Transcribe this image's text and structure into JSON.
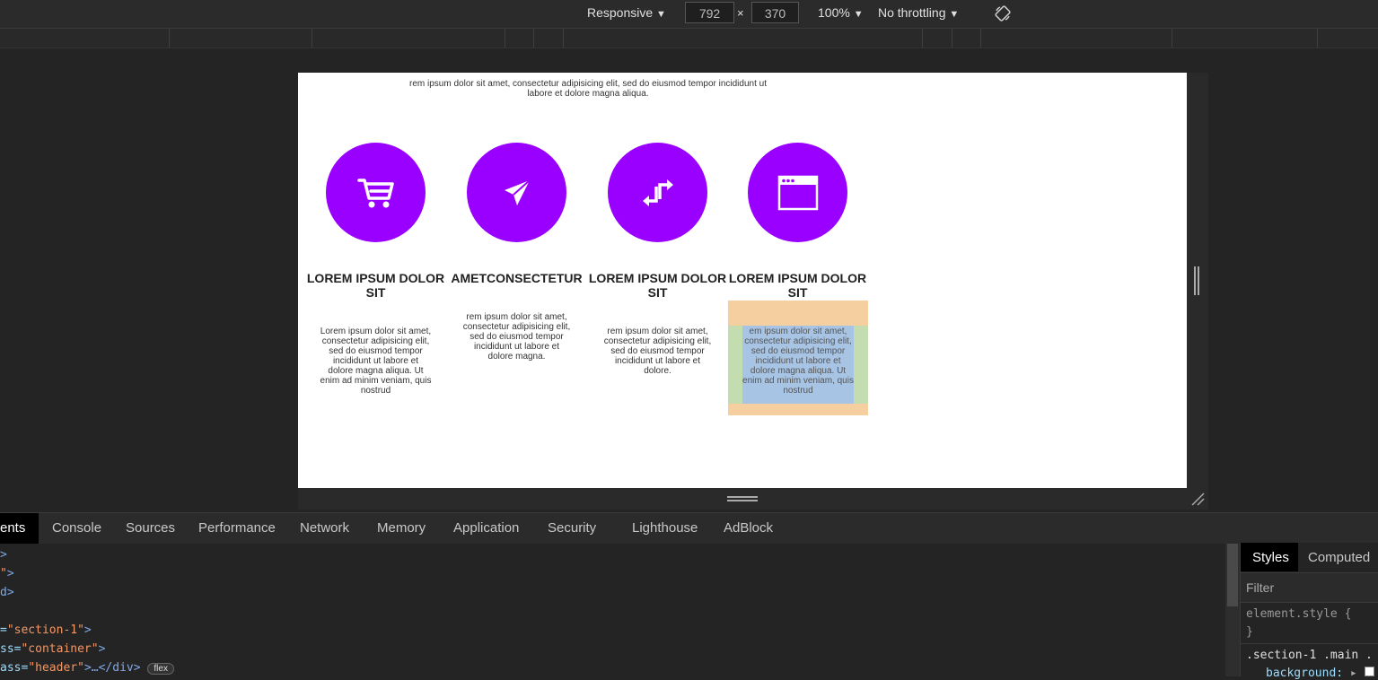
{
  "device_toolbar": {
    "mode": "Responsive",
    "width": "792",
    "times": "×",
    "height": "370",
    "zoom": "100%",
    "throttling": "No throttling",
    "caret": "▼",
    "rotate_icon": "rotate-icon"
  },
  "page": {
    "intro_line1": "rem ipsum dolor sit amet, consectetur adipisicing elit, sed do eiusmod tempor incididunt ut",
    "intro_line2": "labore et dolore magna aliqua.",
    "cards": [
      {
        "icon": "cart-icon",
        "title": "LOREM IPSUM DOLOR SIT",
        "text": "Lorem ipsum dolor sit amet, consectetur adipisicing elit, sed do eiusmod tempor incididunt ut labore et dolore magna aliqua. Ut enim ad minim veniam, quis nostrud"
      },
      {
        "icon": "paper-plane-icon",
        "title": "AMETCONSECTETUR",
        "text": "rem ipsum dolor sit amet, consectetur adipisicing elit, sed do eiusmod tempor incididunt ut labore et dolore magna."
      },
      {
        "icon": "transfer-arrows-icon",
        "title": "LOREM IPSUM DOLOR SIT",
        "text": "rem ipsum dolor sit amet, consectetur adipisicing elit, sed do eiusmod tempor incididunt ut labore et dolore."
      },
      {
        "icon": "browser-window-icon",
        "title": "LOREM IPSUM DOLOR SIT",
        "text": "em ipsum dolor sit amet, consectetur adipisicing elit, sed do eiusmod tempor incididunt ut labore et dolore magna aliqua. Ut enim ad minim veniam, quis nostrud"
      }
    ],
    "accent_color": "#9900ff"
  },
  "devtools": {
    "tabs": [
      "ents",
      "Console",
      "Sources",
      "Performance",
      "Network",
      "Memory",
      "Application",
      "Security",
      "Lighthouse",
      "AdBlock"
    ],
    "active_tab": "ents",
    "dom_lines": {
      "l1": ">",
      "l2_q": "\"",
      "l2_gt": ">",
      "l3": "d>",
      "l5_pre": "=",
      "l5_val": "\"section-1\"",
      "l5_gt": ">",
      "l6_pre": "ss=",
      "l6_val": "\"container\"",
      "l6_gt": ">",
      "l7_pre": "ass=",
      "l7_val": "\"header\"",
      "l7_rest": ">…</div>",
      "l7_badge": "flex"
    },
    "styles_panel": {
      "tabs": [
        "Styles",
        "Computed"
      ],
      "filter_placeholder": "Filter",
      "rule1": "element.style {",
      "rule1_close": "}",
      "rule2": ".section-1 .main .",
      "prop": "background:",
      "prop_arrow": "▸"
    }
  }
}
